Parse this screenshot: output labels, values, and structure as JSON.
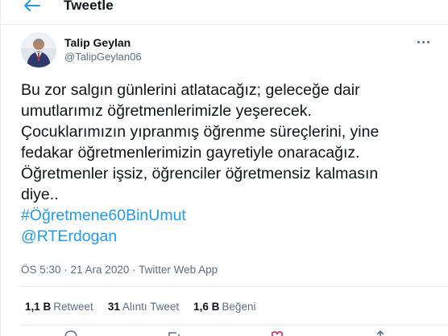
{
  "header": {
    "title": "Tweetle",
    "back_icon": "arrow-left-icon"
  },
  "author": {
    "name": "Talip Geylan",
    "handle": "@TalipGeylan06",
    "avatar_icon": "avatar"
  },
  "tweet": {
    "lines": [
      "Bu zor salgın günlerini atlatacağız; geleceğe dair",
      "umutlarımız öğretmenlerimizle yeşerecek.",
      "Çocuklarımızın yıpranmış öğrenme süreçlerini, yine",
      "fedakar öğretmenlerimizin gayretiyle onaracağız.",
      "Öğretmenler işsiz, öğrenciler öğretmensiz kalmasın",
      "diye.."
    ],
    "hashtag": "#Öğretmene60BinUmut",
    "mention": "@RTErdogan"
  },
  "meta": {
    "time": "ÖS 5:30",
    "separator": " · ",
    "date": "21 Ara 2020",
    "source": "Twitter Web App"
  },
  "stats": {
    "retweets_count": "1,1 B",
    "retweets_label": "Retweet",
    "quotes_count": "31",
    "quotes_label": "Alıntı Tweet",
    "likes_count": "1,6 B",
    "likes_label": "Beğeni"
  },
  "colors": {
    "accent": "#1d9bf0",
    "text": "#0f1419",
    "secondary": "#5b7083",
    "divider": "#ebeef0"
  }
}
